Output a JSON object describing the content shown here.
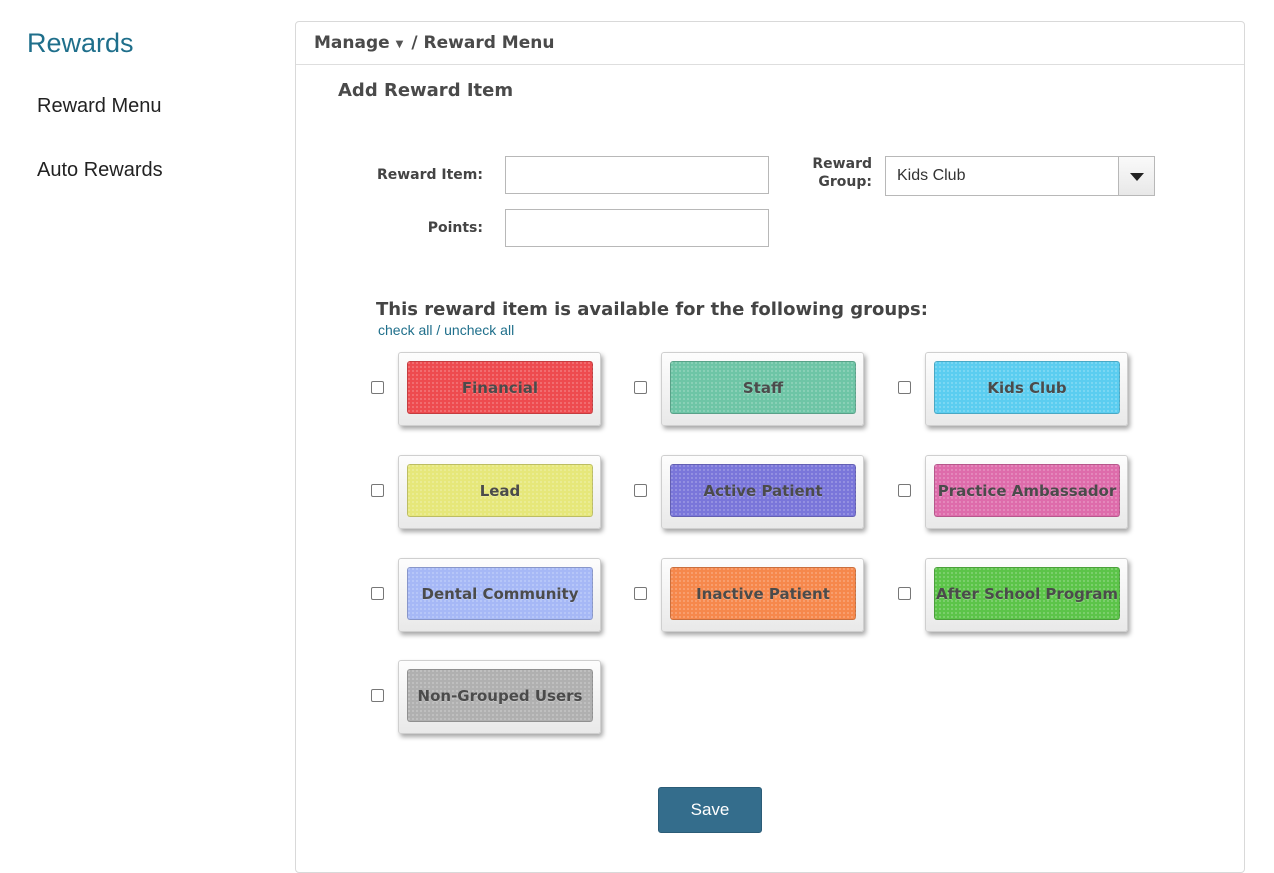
{
  "sidebar": {
    "title": "Rewards",
    "items": [
      {
        "label": "Reward Menu"
      },
      {
        "label": "Auto Rewards"
      }
    ]
  },
  "breadcrumb": {
    "manage": "Manage",
    "separator": "/",
    "current": "Reward Menu"
  },
  "form": {
    "section_title": "Add Reward Item",
    "reward_item_label": "Reward Item:",
    "reward_item_value": "",
    "points_label": "Points:",
    "points_value": "",
    "reward_group_label_line1": "Reward",
    "reward_group_label_line2": "Group:",
    "reward_group_value": "Kids Club"
  },
  "groups": {
    "heading": "This reward item is available for the following groups:",
    "check_all": "check all",
    "links_separator": " / ",
    "uncheck_all": "uncheck all",
    "items": [
      {
        "label": "Financial",
        "color": "#ee4b4f",
        "checked": false
      },
      {
        "label": "Staff",
        "color": "#6ec5a6",
        "checked": false
      },
      {
        "label": "Kids Club",
        "color": "#5bcdf0",
        "checked": false
      },
      {
        "label": "Lead",
        "color": "#e6e77a",
        "checked": false
      },
      {
        "label": "Active Patient",
        "color": "#7a76da",
        "checked": false
      },
      {
        "label": "Practice Ambassador",
        "color": "#de6cab",
        "checked": false
      },
      {
        "label": "Dental Community",
        "color": "#a6b8f6",
        "checked": false
      },
      {
        "label": "Inactive Patient",
        "color": "#f6884c",
        "checked": false
      },
      {
        "label": "After School Program",
        "color": "#5cc449",
        "checked": false
      },
      {
        "label": "Non-Grouped Users",
        "color": "#b0b0b0",
        "checked": false
      }
    ]
  },
  "save_label": "Save"
}
